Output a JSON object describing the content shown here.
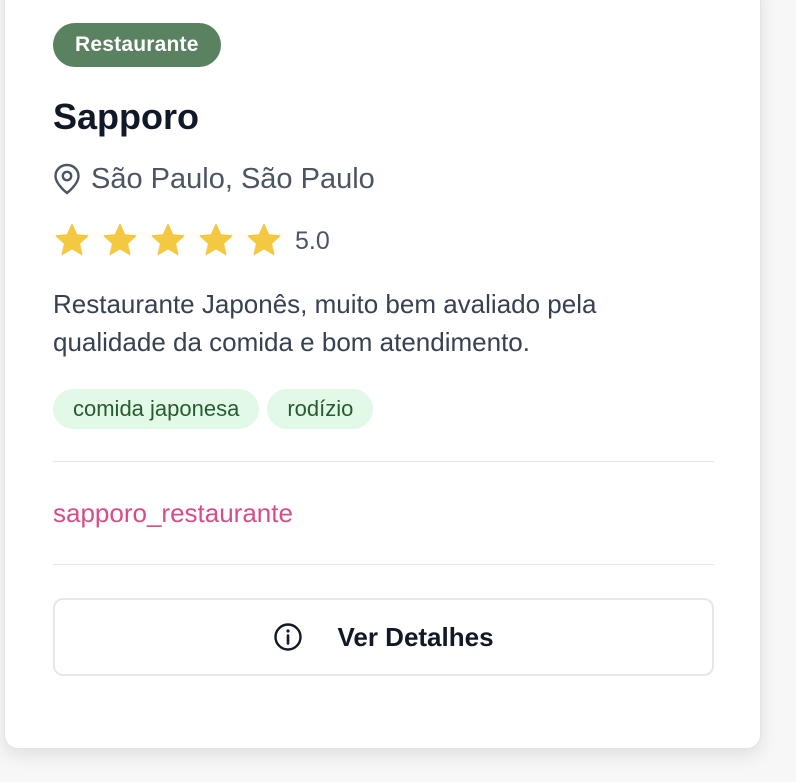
{
  "card": {
    "category": "Restaurante",
    "name": "Sapporo",
    "location": "São Paulo, São Paulo",
    "rating": 5.0,
    "rating_label": "5.0",
    "stars": 5,
    "description": "Restaurante Japonês, muito bem avaliado pela qualidade da comida e bom atendimento.",
    "tags": [
      "comida japonesa",
      "rodízio"
    ],
    "instagram": "sapporo_restaurante",
    "details_button": "Ver Detalhes"
  },
  "icons": {
    "location": "map-pin-icon",
    "star": "star-icon",
    "info": "info-icon"
  },
  "colors": {
    "category_badge": "#5a8160",
    "star": "#f5c842",
    "tag_bg": "#e3f9e7",
    "tag_text": "#285a33",
    "instagram": "#d94c8a"
  }
}
